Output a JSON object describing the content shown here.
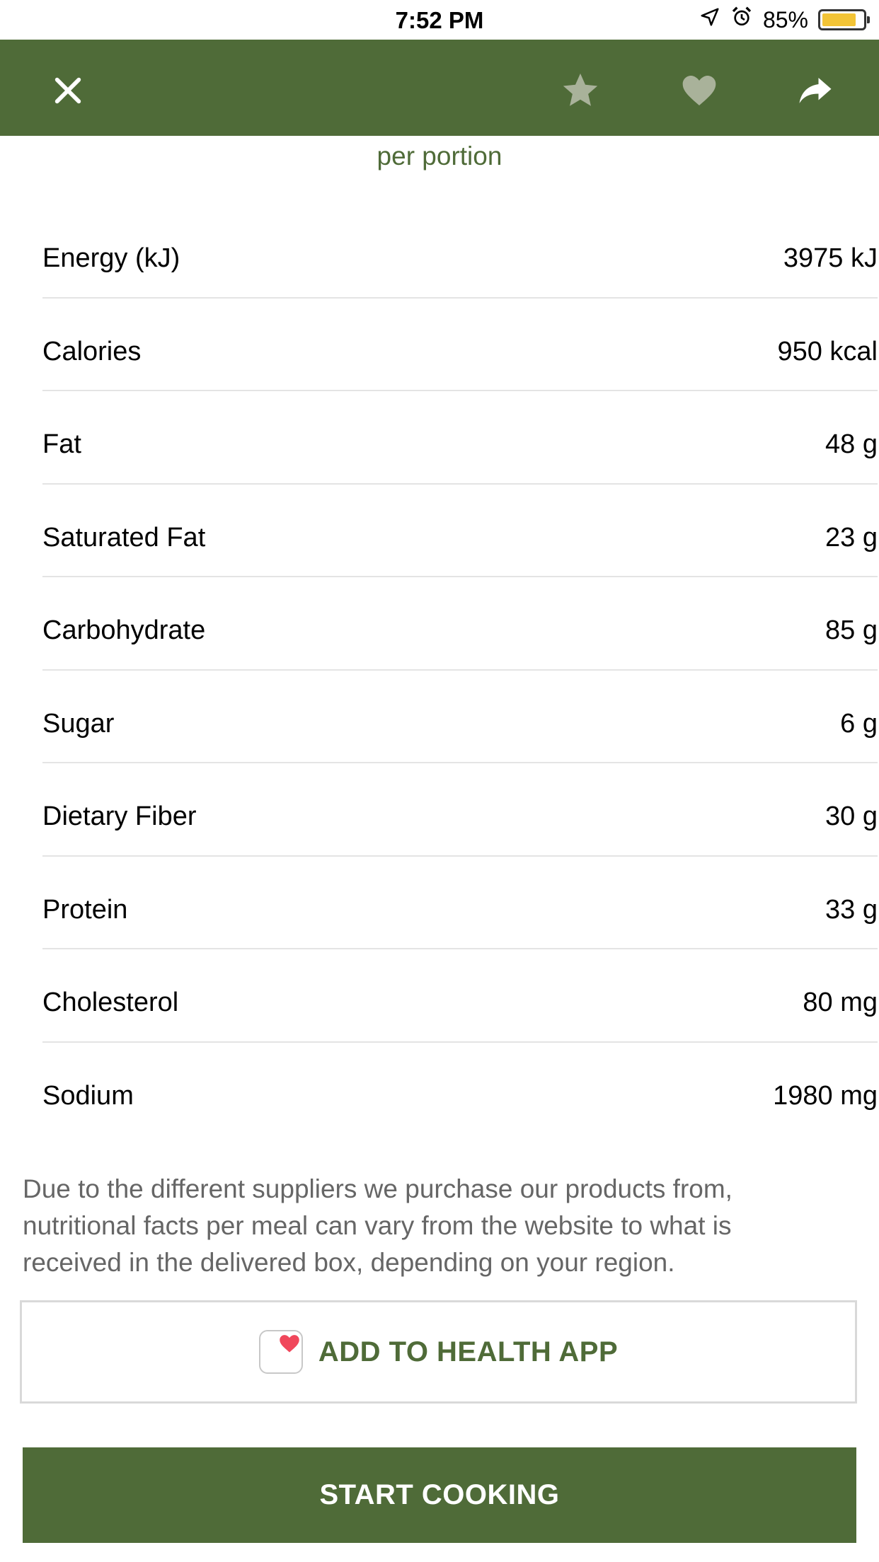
{
  "status_bar": {
    "time": "7:52 PM",
    "battery": "85%",
    "battery_level": 0.85,
    "icons": [
      "location-arrow-icon",
      "alarm-clock-icon",
      "battery-icon"
    ]
  },
  "header": {
    "icons": [
      "close-icon",
      "star-icon",
      "heart-icon",
      "share-icon"
    ]
  },
  "subtitle": "per portion",
  "nutrition": {
    "rows": [
      {
        "label": "Energy (kJ)",
        "value": "3975 kJ"
      },
      {
        "label": "Calories",
        "value": "950 kcal"
      },
      {
        "label": "Fat",
        "value": "48 g"
      },
      {
        "label": "Saturated Fat",
        "value": "23 g"
      },
      {
        "label": "Carbohydrate",
        "value": "85 g"
      },
      {
        "label": "Sugar",
        "value": "6 g"
      },
      {
        "label": "Dietary Fiber",
        "value": "30 g"
      },
      {
        "label": "Protein",
        "value": "33 g"
      },
      {
        "label": "Cholesterol",
        "value": "80 mg"
      },
      {
        "label": "Sodium",
        "value": "1980 mg"
      }
    ]
  },
  "note": "Due to the different suppliers we purchase our products from, nutritional facts per meal can vary from the website to what is received in the delivered box, depending on your region.",
  "buttons": {
    "health": "ADD TO HEALTH APP",
    "cook": "START COOKING"
  },
  "colors": {
    "brand_green": "#4f6b38",
    "battery_yellow": "#f3c436",
    "icon_gray": "#a9b29a"
  }
}
